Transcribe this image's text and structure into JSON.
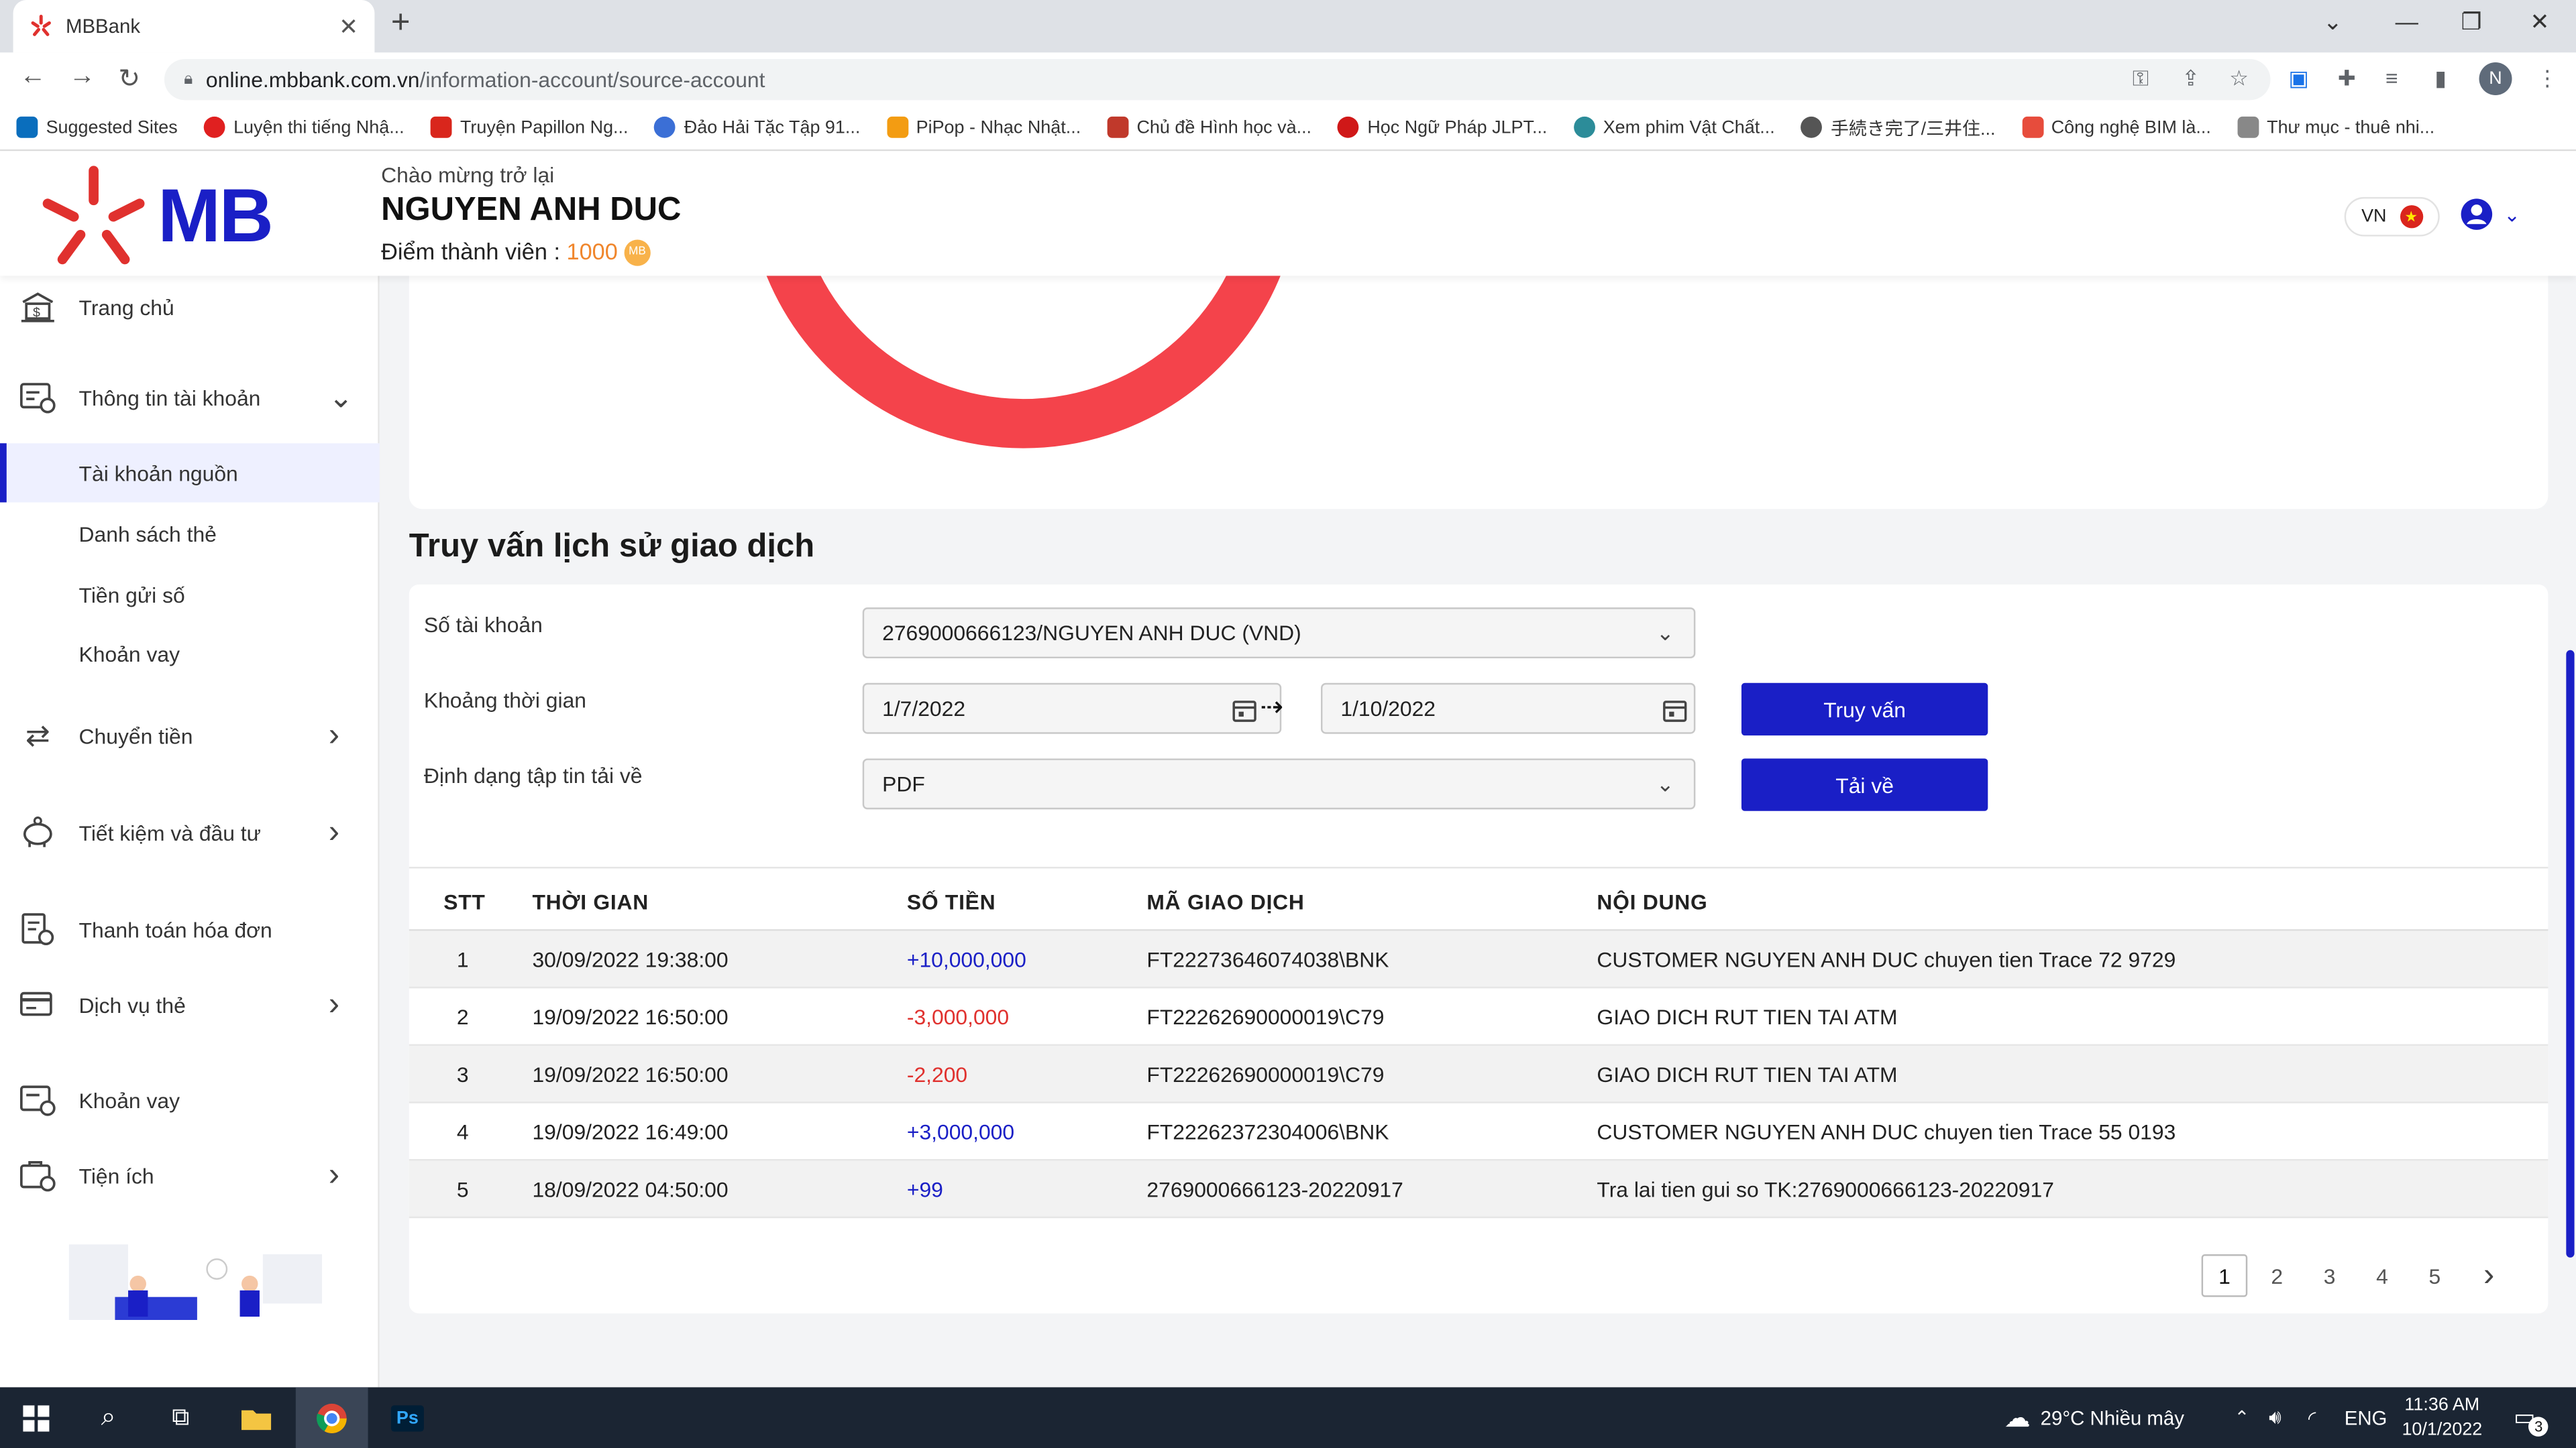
{
  "browser": {
    "tab_title": "MBBank",
    "url_domain": "online.mbbank.com.vn",
    "url_path": "/information-account/source-account",
    "profile_initial": "N",
    "bookmarks": [
      {
        "label": "Suggested Sites",
        "color": "#0a6ebd"
      },
      {
        "label": "Luyện thi tiếng Nhậ...",
        "color": "#e02020"
      },
      {
        "label": "Truyện Papillon Ng...",
        "color": "#d9261c"
      },
      {
        "label": "Đảo Hải Tặc Tập 91...",
        "color": "#3b6fd6"
      },
      {
        "label": "PiPop - Nhạc Nhật...",
        "color": "#f39c12"
      },
      {
        "label": "Chủ đề Hình học và...",
        "color": "#c0392b"
      },
      {
        "label": "Học Ngữ Pháp JLPT...",
        "color": "#d01818"
      },
      {
        "label": "Xem phim Vật Chất...",
        "color": "#2c8c99"
      },
      {
        "label": "手続き完了/三井住...",
        "color": "#555555"
      },
      {
        "label": "Công nghệ BIM là...",
        "color": "#e74c3c"
      },
      {
        "label": "Thư mục - thuê nhi...",
        "color": "#888888"
      }
    ]
  },
  "header": {
    "logo": "MB",
    "welcome": "Chào mừng trở lại",
    "user_name": "NGUYEN ANH DUC",
    "points_label": "Điểm thành viên :",
    "points_value": "1000",
    "coin_text": "MB",
    "lang": "VN",
    "flag_star": "★"
  },
  "sidebar": {
    "home": "Trang chủ",
    "account_info": "Thông tin tài khoản",
    "sub_items": [
      "Tài khoản nguồn",
      "Danh sách thẻ",
      "Tiền gửi số",
      "Khoản vay"
    ],
    "transfer": "Chuyển tiền",
    "savings": "Tiết kiệm và đầu tư",
    "bills": "Thanh toán hóa đơn",
    "card_services": "Dịch vụ thẻ",
    "loan": "Khoản vay",
    "utilities": "Tiện ích"
  },
  "query": {
    "title": "Truy vấn lịch sử giao dịch",
    "account_label": "Số tài khoản",
    "account_value": "2769000666123/NGUYEN ANH DUC (VND)",
    "period_label": "Khoảng thời gian",
    "from_date": "1/7/2022",
    "to_date": "1/10/2022",
    "arrow": "⇢",
    "format_label": "Định dạng tập tin tải về",
    "format_value": "PDF",
    "query_button": "Truy vấn",
    "download_button": "Tải về"
  },
  "table": {
    "headers": [
      "STT",
      "THỜI GIAN",
      "SỐ TIỀN",
      "MÃ GIAO DỊCH",
      "NỘI DUNG"
    ],
    "rows": [
      {
        "stt": "1",
        "time": "30/09/2022 19:38:00",
        "amount": "+10,000,000",
        "type": "pos",
        "code": "FT22273646074038\\BNK",
        "content": "CUSTOMER NGUYEN ANH DUC chuyen tien Trace 72 9729"
      },
      {
        "stt": "2",
        "time": "19/09/2022 16:50:00",
        "amount": "-3,000,000",
        "type": "neg",
        "code": "FT22262690000019\\C79",
        "content": "GIAO DICH RUT TIEN TAI ATM"
      },
      {
        "stt": "3",
        "time": "19/09/2022 16:50:00",
        "amount": "-2,200",
        "type": "neg",
        "code": "FT22262690000019\\C79",
        "content": "GIAO DICH RUT TIEN TAI ATM"
      },
      {
        "stt": "4",
        "time": "19/09/2022 16:49:00",
        "amount": "+3,000,000",
        "type": "pos",
        "code": "FT22262372304006\\BNK",
        "content": "CUSTOMER NGUYEN ANH DUC chuyen tien Trace 55 0193"
      },
      {
        "stt": "5",
        "time": "18/09/2022 04:50:00",
        "amount": "+99",
        "type": "pos",
        "code": "2769000666123-20220917",
        "content": "Tra lai tien gui so TK:2769000666123-20220917"
      }
    ],
    "pages": [
      "1",
      "2",
      "3",
      "4",
      "5"
    ],
    "next": "›"
  },
  "taskbar": {
    "weather": "29°C  Nhiều mây",
    "lang": "ENG",
    "time": "11:36 AM",
    "date": "10/1/2022",
    "notif_count": "3",
    "ps_label": "Ps"
  },
  "colors": {
    "brand_blue": "#1a1fc6",
    "brand_red": "#e0312e",
    "donut": "#f4434b"
  }
}
